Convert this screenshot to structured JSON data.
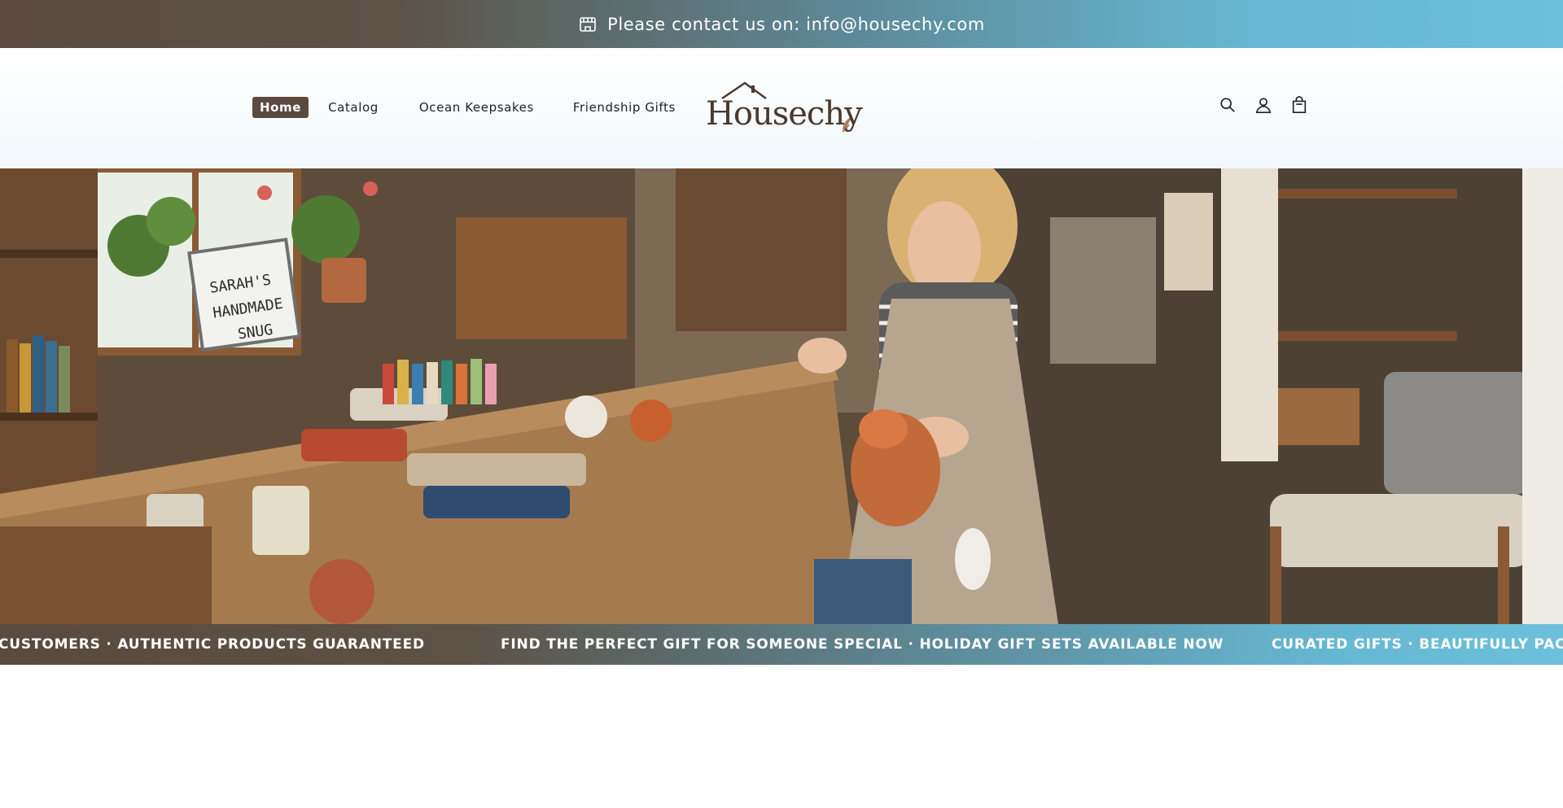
{
  "announcement": {
    "icon": "store-icon",
    "text": "Please contact us on: info@housechy.com"
  },
  "nav": {
    "items": [
      {
        "label": "Home",
        "active": true
      },
      {
        "label": "Catalog",
        "active": false
      },
      {
        "label": "Ocean Keepsakes",
        "active": false
      },
      {
        "label": "Friendship Gifts",
        "active": false
      }
    ]
  },
  "logo": {
    "text": "Housechy"
  },
  "header_icons": [
    "search-icon",
    "account-icon",
    "cart-icon"
  ],
  "hero": {
    "sign_lines": [
      "SARAH'S",
      "HANDMADE",
      "SNUG"
    ]
  },
  "marquee": {
    "items": [
      "CUSTOMERS · AUTHENTIC PRODUCTS GUARANTEED",
      "FIND THE PERFECT GIFT FOR SOMEONE SPECIAL · HOLIDAY GIFT SETS AVAILABLE NOW",
      "CURATED GIFTS · BEAUTIFULLY PACKA"
    ]
  },
  "colors": {
    "brand_brown": "#5a4a3f",
    "accent_blue": "#6cc0da"
  }
}
